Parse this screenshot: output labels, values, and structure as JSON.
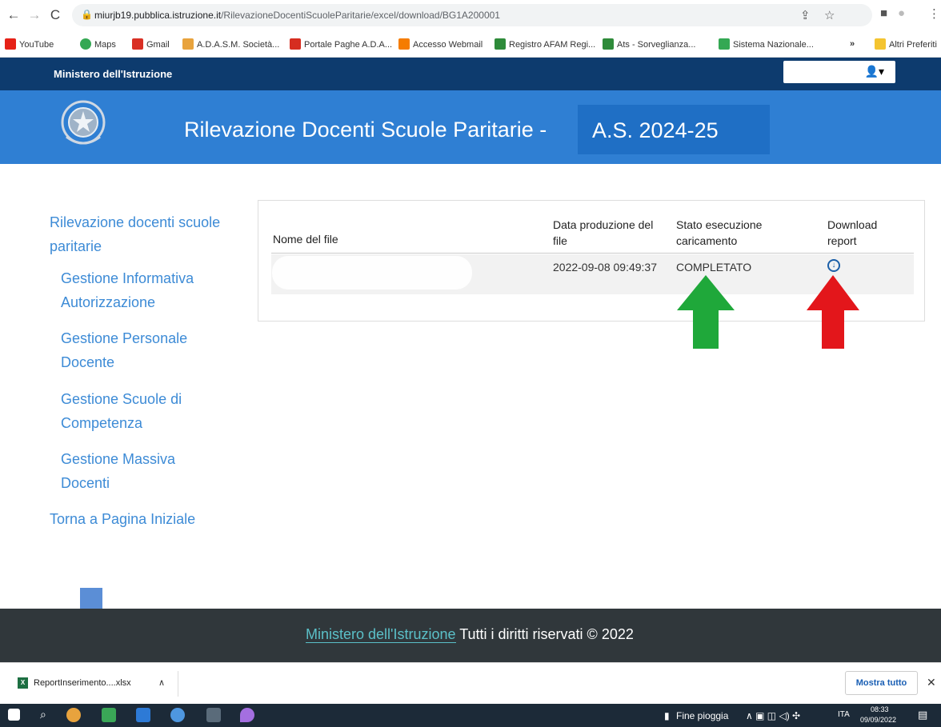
{
  "browser": {
    "url_host": "miurjb19.pubblica.istruzione.it",
    "url_path": "/RilevazioneDocentiScuoleParitarie/excel/download/BG1A200001",
    "bookmarks": [
      {
        "label": "YouTube",
        "color": "#e62117"
      },
      {
        "label": "Maps",
        "color": "#34a853"
      },
      {
        "label": "Gmail",
        "color": "#d93025"
      },
      {
        "label": "A.D.A.S.M. Società...",
        "color": "#e8a33d"
      },
      {
        "label": "Portale Paghe A.D.A...",
        "color": "#d62d20"
      },
      {
        "label": "Accesso Webmail",
        "color": "#f57c00"
      },
      {
        "label": "Registro AFAM Regi...",
        "color": "#2e8b3a"
      },
      {
        "label": "Ats - Sorveglianza...",
        "color": "#2e8b3a"
      },
      {
        "label": "Sistema Nazionale...",
        "color": "#34a853"
      }
    ],
    "more_bookmarks": "»",
    "other_favorites": "Altri Preferiti"
  },
  "header": {
    "ministry": "Ministero dell'Istruzione",
    "title": "Rilevazione Docenti Scuole Paritarie -",
    "year": "A.S. 2024-25",
    "user_icon": "user-icon"
  },
  "sidebar": {
    "items": [
      {
        "label": "Rilevazione docenti scuole paritarie"
      },
      {
        "label": "Gestione Informativa Autorizzazione"
      },
      {
        "label": "Gestione Personale Docente"
      },
      {
        "label": "Gestione Scuole di Competenza"
      },
      {
        "label": "Gestione Massiva Docenti"
      },
      {
        "label": "Torna a Pagina Iniziale"
      }
    ]
  },
  "table": {
    "columns": [
      "Nome del file",
      "Data produzione del file",
      "Stato esecuzione caricamento",
      "Download report"
    ],
    "rows": [
      {
        "name": "",
        "date": "2022-09-08 09:49:37",
        "status": "COMPLETATO",
        "download_icon": "download-icon"
      }
    ]
  },
  "annotations": {
    "green_arrow": "#1fa83a",
    "red_arrow": "#e3161b",
    "blue_arrow": "#5b8ed6"
  },
  "footer": {
    "link": "Ministero dell'Istruzione",
    "text": "Tutti i diritti riservati © 2022"
  },
  "download_bar": {
    "file": "ReportInserimento....xlsx",
    "show_all": "Mostra tutto",
    "close": "✕"
  },
  "taskbar": {
    "weather": "Fine pioggia",
    "lang": "ITA",
    "time": "08:33",
    "date": "09/09/2022"
  }
}
